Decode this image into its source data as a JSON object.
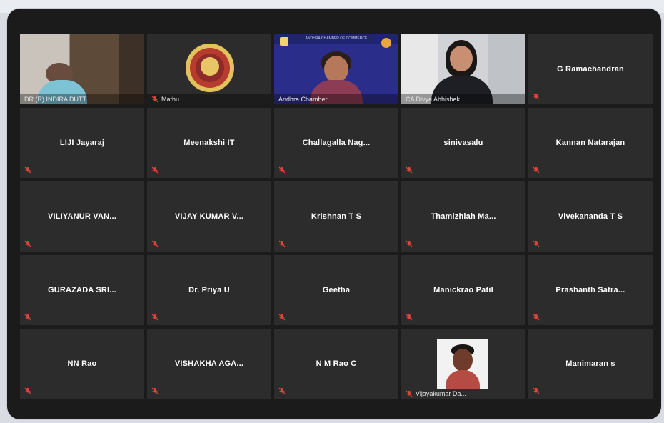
{
  "header": {
    "caption": ""
  },
  "participants": [
    {
      "name": "DR (R) INDIRA DUTT...",
      "type": "video",
      "video_variant": "v1",
      "muted": false
    },
    {
      "name": "Mathu",
      "type": "video",
      "video_variant": "v2",
      "muted": true
    },
    {
      "name": "Andhra Chamber",
      "type": "video",
      "video_variant": "v3",
      "muted": false,
      "active": true,
      "banner_text": "ANDHRA CHAMBER OF COMMERCE"
    },
    {
      "name": "CA Divya Abhishek",
      "type": "video",
      "video_variant": "v4",
      "muted": false
    },
    {
      "name": "G Ramachandran",
      "type": "name",
      "muted": true
    },
    {
      "name": "LIJI Jayaraj",
      "type": "name",
      "muted": true
    },
    {
      "name": "Meenakshi IT",
      "type": "name",
      "muted": true
    },
    {
      "name": "Challagalla  Nag...",
      "type": "name",
      "muted": true
    },
    {
      "name": "sinivasalu",
      "type": "name",
      "muted": true
    },
    {
      "name": "Kannan Natarajan",
      "type": "name",
      "muted": true
    },
    {
      "name": "VILIYANUR VAN...",
      "type": "name",
      "muted": true
    },
    {
      "name": "VIJAY KUMAR V...",
      "type": "name",
      "muted": true
    },
    {
      "name": "Krishnan T S",
      "type": "name",
      "muted": true
    },
    {
      "name": "Thamizhiah  Ma...",
      "type": "name",
      "muted": true
    },
    {
      "name": "Vivekananda T S",
      "type": "name",
      "muted": true
    },
    {
      "name": "GURAZADA SRI...",
      "type": "name",
      "muted": true
    },
    {
      "name": "Dr. Priya U",
      "type": "name",
      "muted": true
    },
    {
      "name": "Geetha",
      "type": "name",
      "muted": true
    },
    {
      "name": "Manickrao Patil",
      "type": "name",
      "muted": true
    },
    {
      "name": "Prashanth  Satra...",
      "type": "name",
      "muted": true
    },
    {
      "name": "NN Rao",
      "type": "name",
      "muted": true
    },
    {
      "name": "VISHAKHA AGA...",
      "type": "name",
      "muted": true
    },
    {
      "name": "N M Rao C",
      "type": "name",
      "muted": true
    },
    {
      "name": "Vijayakumar Da...",
      "type": "photo",
      "muted": true
    },
    {
      "name": "Manimaran s",
      "type": "name",
      "muted": true
    }
  ],
  "colors": {
    "window_bg": "#1b1b1b",
    "tile_bg": "#2c2c2c",
    "active_outline": "#d7e36a",
    "mute_red": "#e0453b"
  },
  "icons": {
    "mute": "microphone-muted-icon"
  }
}
